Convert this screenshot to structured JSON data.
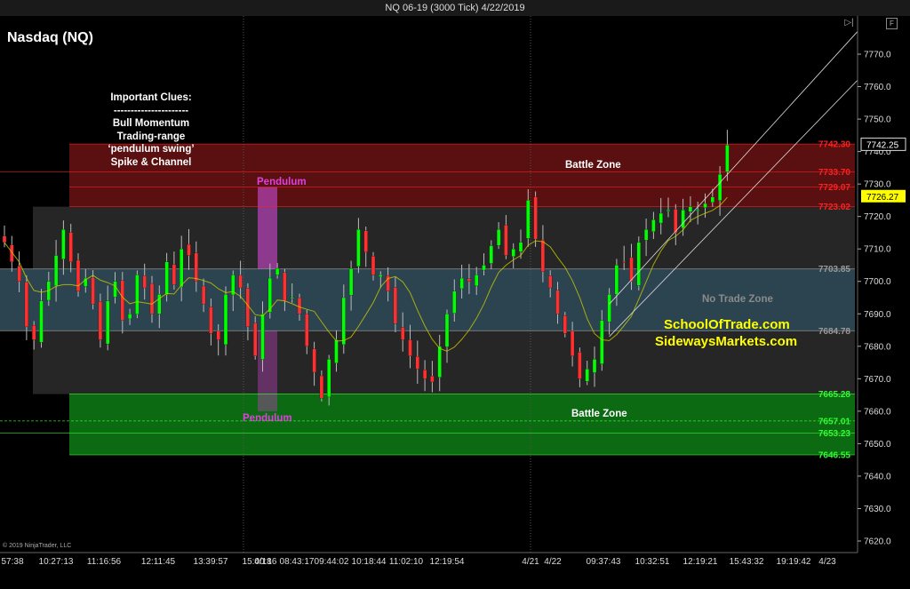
{
  "window": {
    "title": "NQ 06-19 (3000 Tick)  4/22/2019",
    "play_icon": "play-end-icon",
    "f_button": "F"
  },
  "chart_name": "Nasdaq (NQ)",
  "clues": [
    "Important Clues:",
    "----------------------",
    "Bull Momentum",
    "Trading-range",
    "‘pendulum swing’",
    "Spike & Channel"
  ],
  "labels": {
    "pendulum_top": "Pendulum",
    "pendulum_bottom": "Pendulum",
    "battle_zone_top": "Battle Zone",
    "battle_zone_bottom": "Battle Zone",
    "no_trade_zone": "No Trade Zone",
    "brand1": "SchoolOfTrade.com",
    "brand2": "SidewaysMarkets.com",
    "copyright": "© 2019 NinjaTrader, LLC"
  },
  "colors": {
    "red_zone": "#5a1010",
    "dark_zone": "#262626",
    "teal_zone": "#2c4450",
    "green_zone": "#0c6a12",
    "pendulum": "#b040b0",
    "up_bar": "#00ff00",
    "down_bar": "#ff3030",
    "ma": "#c8c800"
  },
  "chart_data": {
    "type": "candlestick",
    "instrument": "NQ 06-19 (3000 Tick)",
    "y_ticks": [
      7620,
      7630,
      7640,
      7650,
      7660,
      7670,
      7680,
      7690,
      7700,
      7710,
      7720,
      7730,
      7740,
      7750,
      7760,
      7770
    ],
    "ylim": [
      7615,
      7777
    ],
    "x_ticks": [
      "57:38",
      "10:27:13",
      "11:16:56",
      "12:11:45",
      "13:39:57",
      "15:00:16",
      "4/18",
      "08:43:17",
      "09:44:02",
      "10:18:44",
      "11:02:10",
      "12:19:54",
      "4/21",
      "4/22",
      "09:37:43",
      "10:32:51",
      "12:19:21",
      "15:43:32",
      "19:19:42",
      "4/23"
    ],
    "price_levels": [
      {
        "label": "7742.30",
        "value": 7742.3,
        "color": "#ff2020"
      },
      {
        "label": "7733.70",
        "value": 7733.7,
        "color": "#ff2020"
      },
      {
        "label": "7729.07",
        "value": 7729.07,
        "color": "#ff2020"
      },
      {
        "label": "7723.02",
        "value": 7723.02,
        "color": "#ff2020"
      },
      {
        "label": "7703.85",
        "value": 7703.85,
        "color": "#9a9a9a"
      },
      {
        "label": "7684.78",
        "value": 7684.78,
        "color": "#9a9a9a"
      },
      {
        "label": "7665.28",
        "value": 7665.28,
        "color": "#30ff30"
      },
      {
        "label": "7657.01",
        "value": 7657.01,
        "color": "#30ff30"
      },
      {
        "label": "7653.23",
        "value": 7653.23,
        "color": "#30ff30"
      },
      {
        "label": "7646.55",
        "value": 7646.55,
        "color": "#30ff30"
      }
    ],
    "current_price": {
      "label": "7742.25",
      "value": 7742.25
    },
    "marker_price": {
      "label": "7726.27",
      "value": 7726.27
    },
    "zones": [
      {
        "name": "battle-zone-upper",
        "from": 7723.02,
        "to": 7742.3
      },
      {
        "name": "trading-range",
        "from": 7665.28,
        "to": 7723.02
      },
      {
        "name": "no-trade-zone",
        "from": 7684.78,
        "to": 7703.85
      },
      {
        "name": "battle-zone-lower",
        "from": 7646.55,
        "to": 7665.28
      }
    ],
    "pendulums": [
      {
        "name": "pendulum-top",
        "from": 7703.85,
        "to": 7729.07
      },
      {
        "name": "pendulum-bottom",
        "from": 7660,
        "to": 7684.78
      }
    ],
    "close_path": [
      7712,
      7706,
      7700,
      7686,
      7682,
      7694,
      7700,
      7708,
      7716,
      7706,
      7697,
      7701,
      7693,
      7682,
      7694,
      7700,
      7688,
      7690,
      7702,
      7698,
      7690,
      7696,
      7706,
      7699,
      7710,
      7708,
      7700,
      7693,
      7684,
      7682,
      7696,
      7702,
      7698,
      7686,
      7677,
      7690,
      7701,
      7704,
      7694,
      7695,
      7690,
      7680,
      7672,
      7664,
      7676,
      7682,
      7695,
      7704,
      7716,
      7709,
      7702,
      7702,
      7697,
      7687,
      7682,
      7677,
      7673,
      7670,
      7669,
      7680,
      7690,
      7697,
      7701,
      7700,
      7702,
      7705,
      7711,
      7716,
      7708,
      7710,
      7712,
      7725,
      7713,
      7703,
      7698,
      7690,
      7684,
      7677,
      7670,
      7673,
      7676,
      7688,
      7696,
      7705,
      7706,
      7700,
      7712,
      7716,
      7719,
      7721,
      7722,
      7715,
      7722,
      7723,
      7722,
      7724,
      7726,
      7733,
      7742
    ],
    "channel_lines": [
      {
        "from_index": 82,
        "from_value": 7693,
        "to_index": 99,
        "to_value": 7777
      },
      {
        "from_index": 82,
        "from_value": 7683,
        "to_index": 99,
        "to_value": 7762
      }
    ]
  }
}
